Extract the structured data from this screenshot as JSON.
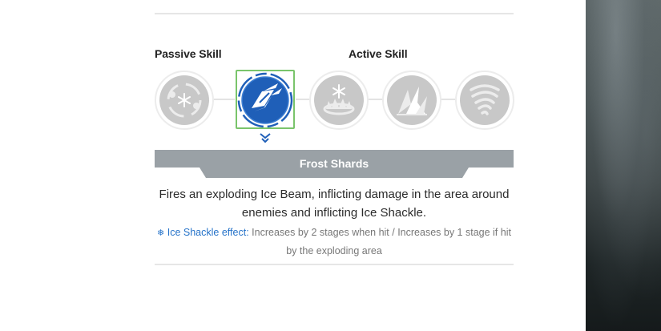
{
  "sections": {
    "passive_label": "Passive Skill",
    "active_label": "Active Skill"
  },
  "skills": [
    {
      "icon": "passive-orbit-snowflake-icon",
      "selected": false
    },
    {
      "icon": "frost-shards-icon",
      "selected": true
    },
    {
      "icon": "ice-crown-snowflake-icon",
      "selected": false
    },
    {
      "icon": "ice-spikes-icon",
      "selected": false
    },
    {
      "icon": "frost-tornado-icon",
      "selected": false
    }
  ],
  "selected_skill": {
    "name": "Frost Shards",
    "description": "Fires an exploding Ice Beam, inflicting damage in the area around enemies and inflicting Ice Shackle.",
    "effect_symbol": "❄",
    "effect_name": "Ice Shackle effect:",
    "effect_text": "Increases by 2 stages when hit / Increases by 1 stage if hit by the exploding area"
  },
  "colors": {
    "accent_blue": "#1f5fb8",
    "selection_green": "#7ac46b",
    "inactive_icon": "#c8c8c8",
    "name_bar": "#9aa1a6"
  }
}
